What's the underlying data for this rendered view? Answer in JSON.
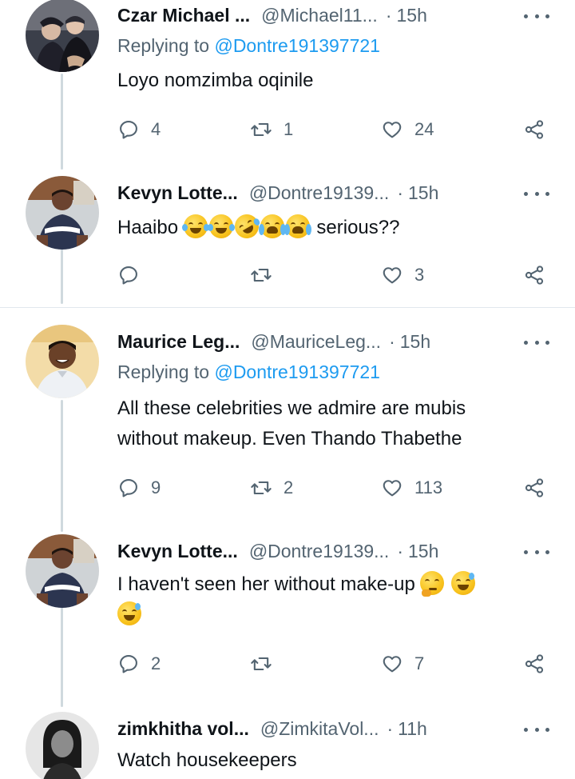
{
  "tweets": [
    {
      "name": "Czar Michael ...",
      "handle": "@Michael11...",
      "dot": "·",
      "time": "15h",
      "replying_prefix": "Replying to",
      "replying_to": "@Dontre191397721",
      "text": "Loyo nomzimba oqinile",
      "replies": "4",
      "retweets": "1",
      "likes": "24",
      "avatar_icon": "avatar-couple-photo"
    },
    {
      "name": "Kevyn Lotte...",
      "handle": "@Dontre19139...",
      "dot": "·",
      "time": "15h",
      "text_before": "Haaibo",
      "text_after": "serious??",
      "emojis": [
        "face-with-tears-of-joy",
        "face-with-tears-of-joy",
        "rolling-on-floor-laughing",
        "loudly-crying-face",
        "loudly-crying-face"
      ],
      "replies": "",
      "retweets": "",
      "likes": "3",
      "avatar_icon": "avatar-man-jersey-photo"
    },
    {
      "name": "Maurice Leg...",
      "handle": "@MauriceLeg...",
      "dot": "·",
      "time": "15h",
      "replying_prefix": "Replying to",
      "replying_to": "@Dontre191397721",
      "text_line1": "All these celebrities we admire are mubis",
      "text_line2": "without makeup. Even Thando Thabethe",
      "replies": "9",
      "retweets": "2",
      "likes": "113",
      "avatar_icon": "avatar-man-smiling-photo"
    },
    {
      "name": "Kevyn Lotte...",
      "handle": "@Dontre19139...",
      "dot": "·",
      "time": "15h",
      "text": "I haven't seen her without make-up",
      "emojis": [
        "thinking-face",
        "grinning-face-with-sweat",
        "grinning-face-with-sweat"
      ],
      "replies": "2",
      "retweets": "",
      "likes": "7",
      "avatar_icon": "avatar-man-jersey-photo"
    },
    {
      "name": "zimkhitha vol...",
      "handle": "@ZimkitaVol...",
      "dot": "·",
      "time": "11h",
      "text": "Watch housekeepers",
      "avatar_icon": "avatar-woman-bw-photo"
    }
  ],
  "colors": {
    "text": "#0f1419",
    "secondary": "#536471",
    "link": "#1d9bf0",
    "thread_line": "#cfd9de",
    "divider": "#e1e8ed"
  }
}
